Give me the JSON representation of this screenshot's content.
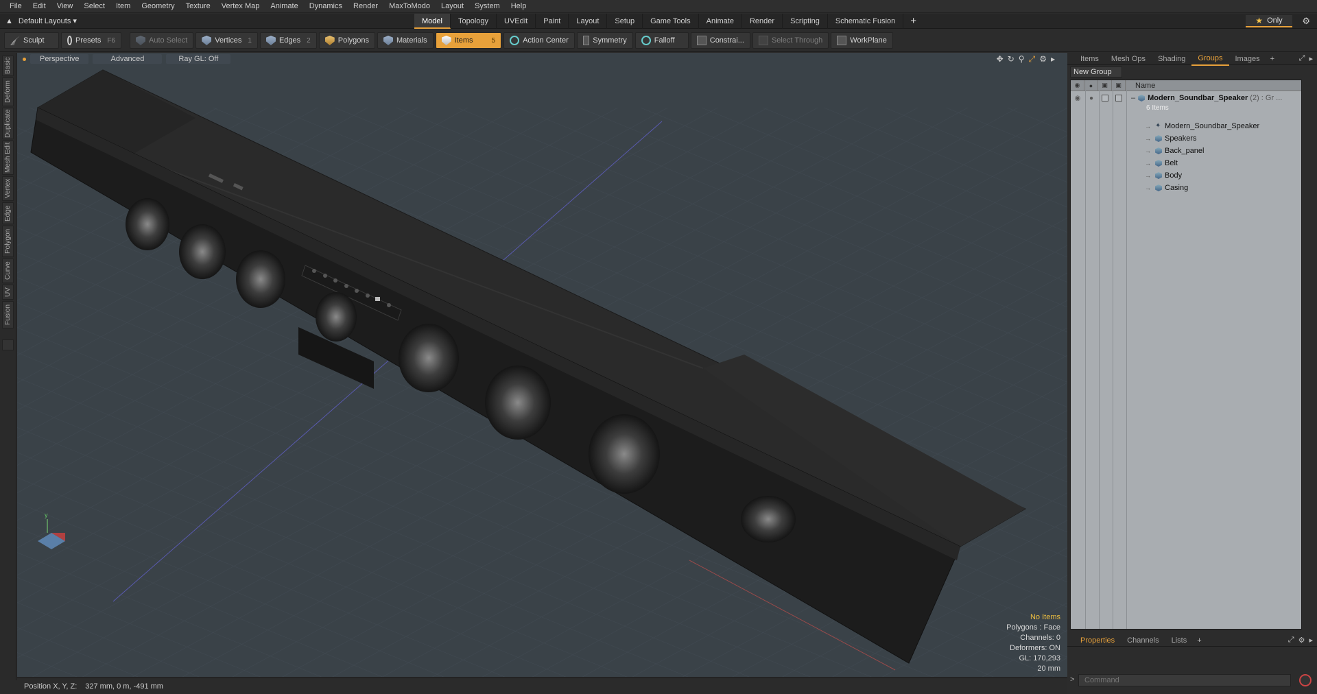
{
  "menu": [
    "File",
    "Edit",
    "View",
    "Select",
    "Item",
    "Geometry",
    "Texture",
    "Vertex Map",
    "Animate",
    "Dynamics",
    "Render",
    "MaxToModo",
    "Layout",
    "System",
    "Help"
  ],
  "layout_selector": "Default Layouts ▾",
  "tabs": [
    "Model",
    "Topology",
    "UVEdit",
    "Paint",
    "Layout",
    "Setup",
    "Game Tools",
    "Animate",
    "Render",
    "Scripting",
    "Schematic Fusion"
  ],
  "active_tab": "Model",
  "only_label": "Only",
  "toolbar": {
    "sculpt": "Sculpt",
    "presets": "Presets",
    "presets_key": "F6",
    "auto_select": "Auto Select",
    "vertices": "Vertices",
    "vertices_count": "1",
    "edges": "Edges",
    "edges_count": "2",
    "polygons": "Polygons",
    "materials": "Materials",
    "items": "Items",
    "items_count": "5",
    "action_center": "Action Center",
    "symmetry": "Symmetry",
    "falloff": "Falloff",
    "constraints": "Constrai...",
    "select_through": "Select Through",
    "workplane": "WorkPlane"
  },
  "left_tabs": [
    "Basic",
    "Deform",
    "Duplicate",
    "Mesh Edit",
    "Vertex",
    "Edge",
    "Polygon",
    "Curve",
    "UV",
    "Fusion"
  ],
  "viewport": {
    "view": "Perspective",
    "shading": "Advanced",
    "raygl": "Ray GL: Off",
    "stats": {
      "no_items": "No Items",
      "polygons": "Polygons : Face",
      "channels": "Channels: 0",
      "deformers": "Deformers: ON",
      "gl": "GL: 170,293",
      "scale": "20 mm"
    }
  },
  "status": {
    "label": "Position X, Y, Z:",
    "value": "327 mm, 0 m, -491 mm"
  },
  "right_panel": {
    "tabs": [
      "Items",
      "Mesh Ops",
      "Shading",
      "Groups",
      "Images"
    ],
    "active_tab": "Groups",
    "new_group": "New Group",
    "name_header": "Name",
    "root": {
      "label": "Modern_Soundbar_Speaker",
      "suffix": "(2) : Gr ...",
      "sub": "6 Items"
    },
    "children": [
      "Modern_Soundbar_Speaker",
      "Speakers",
      "Back_panel",
      "Belt",
      "Body",
      "Casing"
    ],
    "bottom_tabs": [
      "Properties",
      "Channels",
      "Lists"
    ],
    "bottom_active": "Properties",
    "command_placeholder": "Command"
  },
  "colors": {
    "accent": "#e8a13a",
    "viewport_bg": "#3a4248",
    "list_bg": "#a9adb1"
  }
}
